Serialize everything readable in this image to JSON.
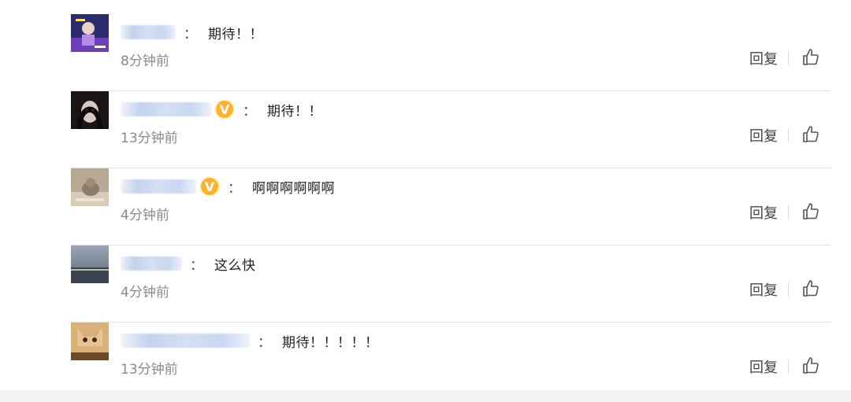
{
  "comments": [
    {
      "text": "期待！！",
      "time": "8分钟前",
      "reply": "回复",
      "vip": false
    },
    {
      "text": "期待！！",
      "time": "13分钟前",
      "reply": "回复",
      "vip": true
    },
    {
      "text": "啊啊啊啊啊啊",
      "time": "4分钟前",
      "reply": "回复",
      "vip": true
    },
    {
      "text": "这么快",
      "time": "4分钟前",
      "reply": "回复",
      "vip": false
    },
    {
      "text": "期待！！！！！",
      "time": "13分钟前",
      "reply": "回复",
      "vip": false
    }
  ],
  "separator": "：",
  "vip_letter": "V",
  "icons": {
    "like": "thumbs-up-icon",
    "vip": "vip-badge-icon"
  },
  "colors": {
    "vip": "#ffb22e",
    "username_blur": "#c3d2ee",
    "timestamp": "#8a8a8a",
    "text": "#222222"
  }
}
